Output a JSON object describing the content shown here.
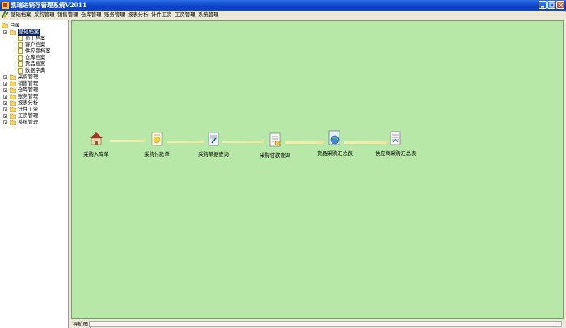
{
  "window": {
    "title": "凯瑞进销存管理系统V2011"
  },
  "menu": [
    "基础档案",
    "采购管理",
    "销售管理",
    "仓库管理",
    "账务管理",
    "报表分析",
    "计件工资",
    "工资管理",
    "系统管理"
  ],
  "tree": {
    "root": "目录",
    "groups": [
      {
        "label": "基础档案",
        "expanded": true,
        "children": [
          "员工档案",
          "客户档案",
          "供应商档案",
          "仓库档案",
          "货品档案",
          "数据字典"
        ]
      },
      {
        "label": "采购管理"
      },
      {
        "label": "销售管理"
      },
      {
        "label": "仓库管理"
      },
      {
        "label": "账务管理"
      },
      {
        "label": "报表分析"
      },
      {
        "label": "计件工资"
      },
      {
        "label": "工资管理"
      },
      {
        "label": "系统管理"
      }
    ]
  },
  "flow": [
    {
      "label": "采购入库单",
      "icon": "warehouse-icon"
    },
    {
      "label": "采购付款单",
      "icon": "payment-doc-icon"
    },
    {
      "label": "采购单据查询",
      "icon": "document-query-icon"
    },
    {
      "label": "采购付款查询",
      "icon": "payment-query-icon"
    },
    {
      "label": "货品采购汇总表",
      "icon": "globe-report-icon"
    },
    {
      "label": "供应商采购汇总表",
      "icon": "supplier-report-icon"
    }
  ],
  "status": {
    "tab": "导航图"
  },
  "colors": {
    "canvas": "#b8e8a8",
    "titlebar": "#0a3fc2",
    "selection": "#0a246a"
  }
}
